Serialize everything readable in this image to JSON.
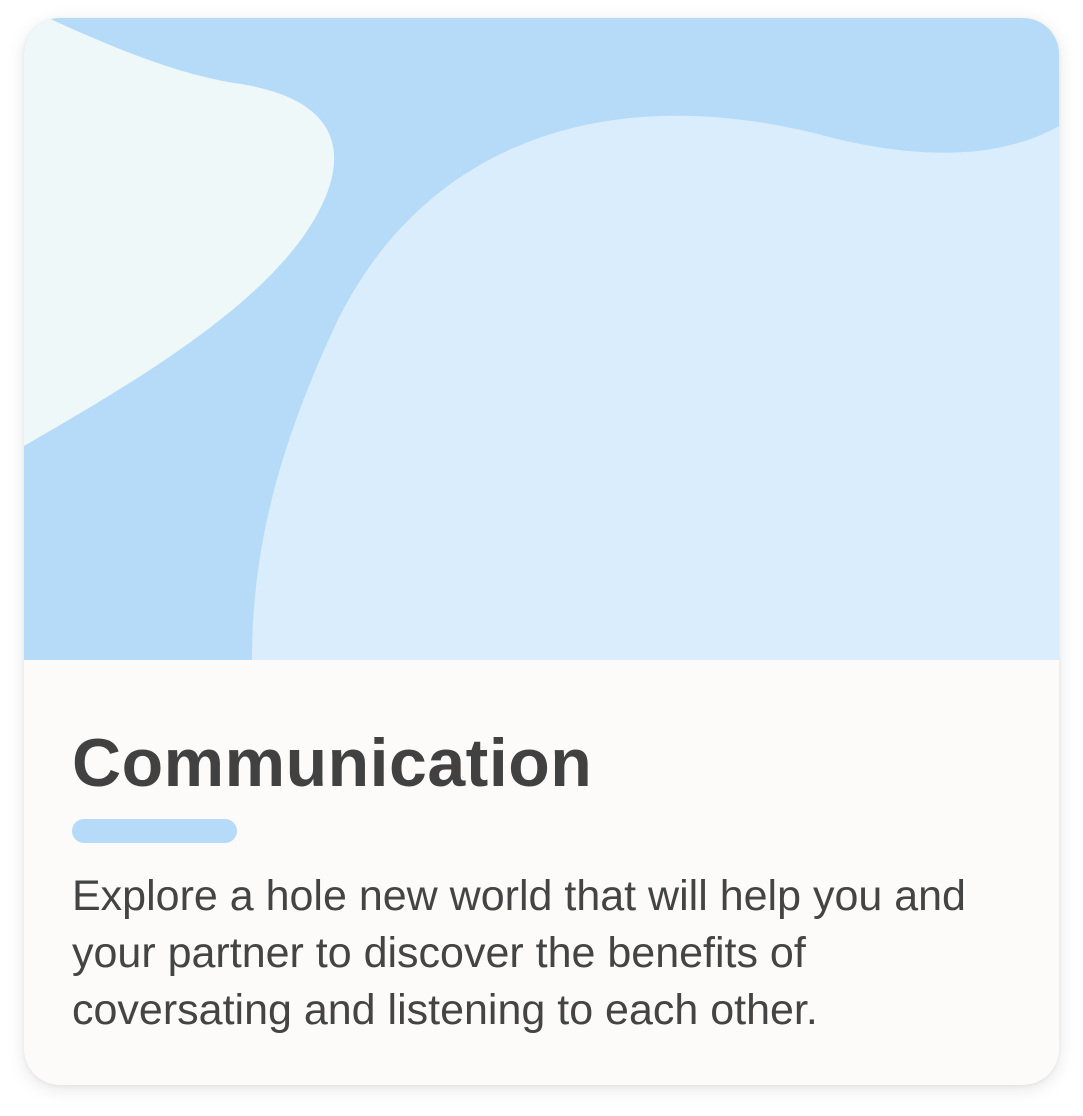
{
  "card": {
    "title": "Communication",
    "description": "Explore a hole new world that will help you and your partner to discover the benefits of coversating and listening to each other."
  },
  "colors": {
    "hero_base": "#b6dbf8",
    "hero_light_shape": "#daedfc",
    "hero_pale_shape": "#eef8f9",
    "accent_bar": "#b6dbf8",
    "card_background": "#fcfbfa",
    "title_text": "#414141",
    "body_text": "#444444"
  }
}
